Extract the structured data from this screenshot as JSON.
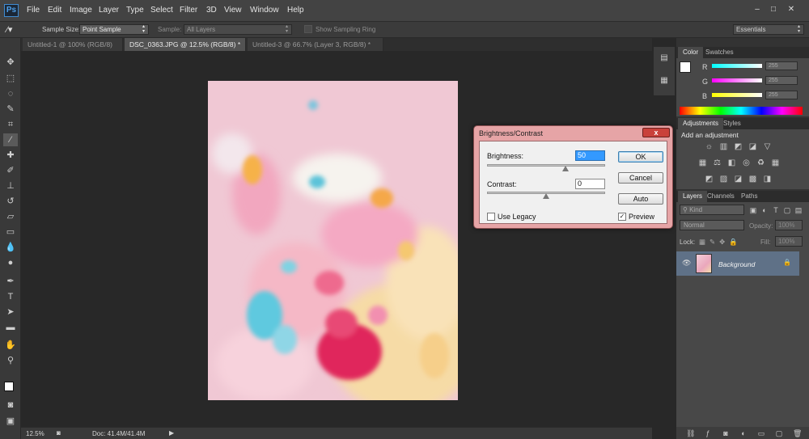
{
  "app": {
    "logo": "Ps"
  },
  "menu": [
    "File",
    "Edit",
    "Image",
    "Layer",
    "Type",
    "Select",
    "Filter",
    "3D",
    "View",
    "Window",
    "Help"
  ],
  "window_controls": {
    "minimize": "–",
    "restore": "□",
    "close": "✕"
  },
  "options_bar": {
    "sample_size_label": "Sample Size:",
    "sample_size_value": "Point Sample",
    "sample_label": "Sample:",
    "sample_value": "All Layers",
    "sampling_ring_label": "Show Sampling Ring",
    "workspace": "Essentials"
  },
  "doc_tabs": [
    {
      "label": "Untitled-1 @ 100% (RGB/8)",
      "active": false
    },
    {
      "label": "DSC_0363.JPG @ 12.5% (RGB/8) *",
      "active": true
    },
    {
      "label": "Untitled-3 @ 66.7% (Layer 3, RGB/8) *",
      "active": false
    }
  ],
  "status": {
    "zoom": "12.5%",
    "doc": "Doc: 41.4M/41.4M"
  },
  "color_panel": {
    "tabs": [
      "Color",
      "Swatches"
    ],
    "channels": [
      {
        "label": "R",
        "value": "255",
        "color": "#00e5ff"
      },
      {
        "label": "G",
        "value": "255",
        "color": "#ff33ff"
      },
      {
        "label": "B",
        "value": "255",
        "color": "#ffff33"
      }
    ]
  },
  "adjustments_panel": {
    "tabs": [
      "Adjustments",
      "Styles"
    ],
    "heading": "Add an adjustment"
  },
  "layers_panel": {
    "tabs": [
      "Layers",
      "Channels",
      "Paths"
    ],
    "kind": "Kind",
    "blend_mode": "Normal",
    "opacity_label": "Opacity:",
    "opacity_value": "100%",
    "lock_label": "Lock:",
    "fill_label": "Fill:",
    "fill_value": "100%",
    "layer_name": "Background"
  },
  "dialog": {
    "title": "Brightness/Contrast",
    "close": "x",
    "brightness_label": "Brightness:",
    "brightness_value": "50",
    "contrast_label": "Contrast:",
    "contrast_value": "0",
    "ok": "OK",
    "cancel": "Cancel",
    "auto": "Auto",
    "use_legacy": "Use Legacy",
    "preview": "Preview",
    "preview_check": "✓"
  }
}
